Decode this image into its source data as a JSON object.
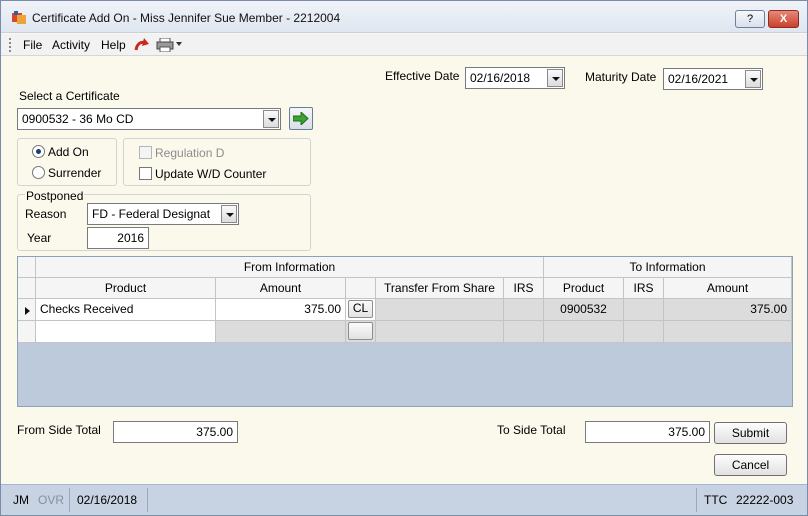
{
  "window": {
    "title": "Certificate Add On - Miss Jennifer Sue Member - 2212004",
    "help_label": "?",
    "close_label": "X"
  },
  "menu": {
    "file": "File",
    "activity": "Activity",
    "help": "Help"
  },
  "effective_date": {
    "label": "Effective Date",
    "value": "02/16/2018"
  },
  "maturity_date": {
    "label": "Maturity Date",
    "value": "02/16/2021"
  },
  "certificate": {
    "label": "Select a Certificate",
    "value": "0900532 - 36 Mo CD"
  },
  "action_group": {
    "add_on": {
      "label": "Add On",
      "checked": true
    },
    "surrender": {
      "label": "Surrender",
      "checked": false
    }
  },
  "options_group": {
    "regulation_d": {
      "label": "Regulation D",
      "checked": false,
      "disabled": true
    },
    "update_wd": {
      "label": "Update W/D Counter",
      "checked": false
    }
  },
  "postponed": {
    "title": "Postponed",
    "reason_label": "Reason",
    "reason_value": "FD - Federal Designat",
    "year_label": "Year",
    "year_value": "2016"
  },
  "grid": {
    "group_from": "From Information",
    "group_to": "To Information",
    "columns": {
      "product": "Product",
      "amount": "Amount",
      "transfer_from_share": "Transfer From Share",
      "irs": "IRS",
      "to_product": "Product",
      "to_irs": "IRS",
      "to_amount": "Amount"
    },
    "rows": [
      {
        "product": "Checks Received",
        "amount": "375.00",
        "button": "CL",
        "transfer_from_share": "",
        "irs": "",
        "to_product": "0900532",
        "to_irs": "",
        "to_amount": "375.00"
      }
    ]
  },
  "totals": {
    "from_label": "From Side Total",
    "from_value": "375.00",
    "to_label": "To Side Total",
    "to_value": "375.00"
  },
  "buttons": {
    "submit": "Submit",
    "cancel": "Cancel"
  },
  "statusbar": {
    "user": "JM",
    "ovr": "OVR",
    "date": "02/16/2018",
    "ttc_label": "TTC",
    "ttc_value": "22222-003"
  },
  "icons": [
    "app-icon",
    "redo-icon",
    "printer-icon",
    "go-arrow-icon",
    "dropdown-arrow-icon",
    "row-pointer-icon"
  ]
}
